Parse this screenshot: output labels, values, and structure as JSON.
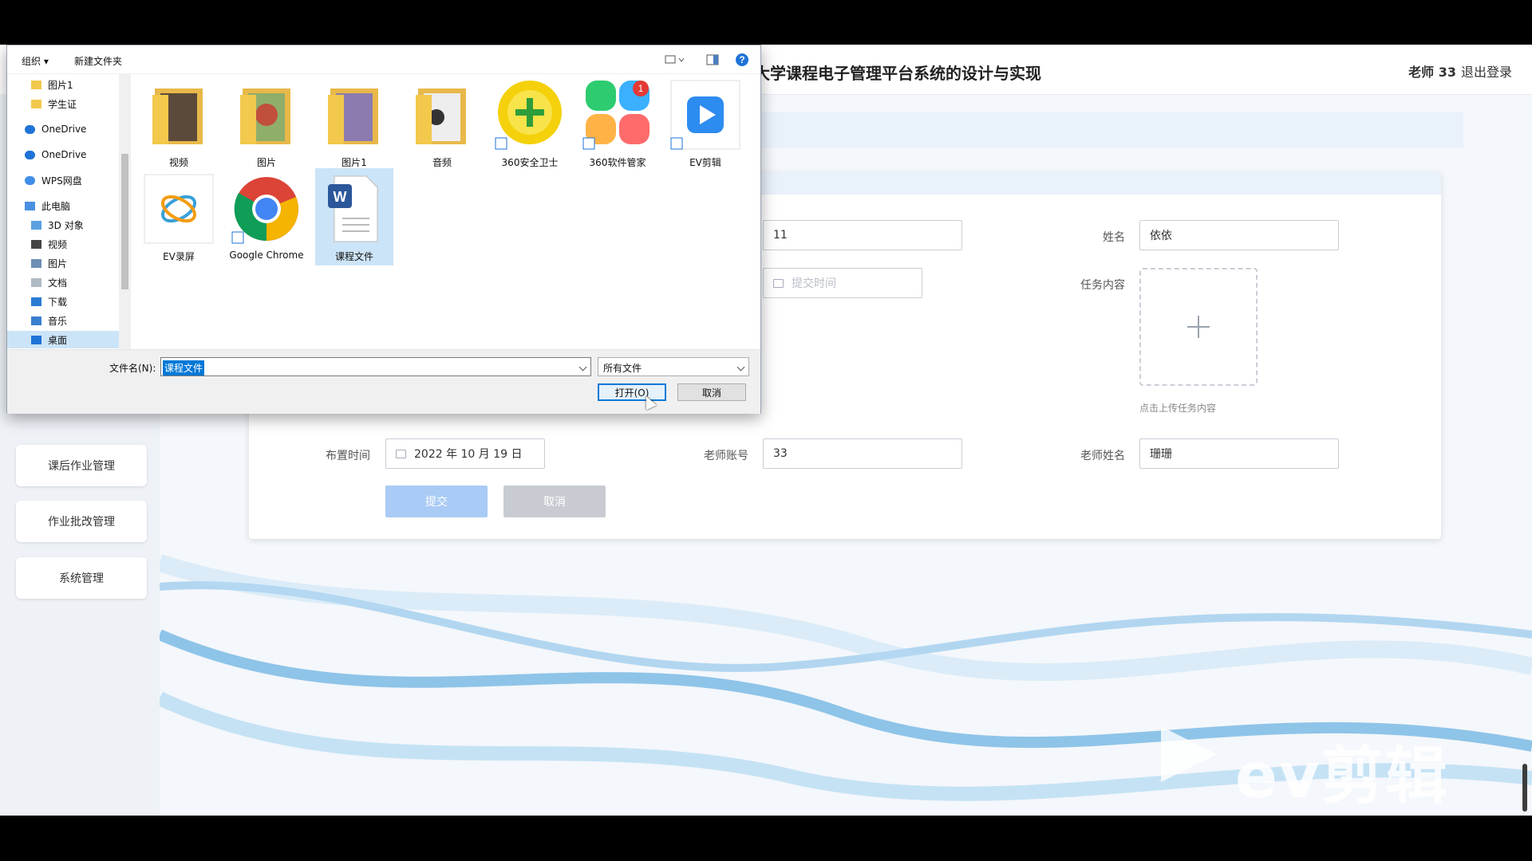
{
  "header": {
    "title": "大学课程电子管理平台系统的设计与实现",
    "user": "老师 33",
    "logout": "退出登录"
  },
  "sidebar": {
    "items": [
      "课后作业管理",
      "作业批改管理",
      "系统管理"
    ]
  },
  "form": {
    "field1_value": "11",
    "name_label": "姓名",
    "name_value": "依依",
    "submit_time_placeholder": "提交时间",
    "task_content_label": "任务内容",
    "upload_hint": "点击上传任务内容",
    "assign_time_label": "布置时间",
    "assign_time_value": "2022 年 10 月 19 日",
    "teacher_account_label": "老师账号",
    "teacher_account_value": "33",
    "teacher_name_label": "老师姓名",
    "teacher_name_value": "珊珊",
    "submit_button": "提交",
    "cancel_button": "取消"
  },
  "watermark": "ev剪辑",
  "dialog": {
    "toolbar": {
      "organize": "组织 ▾",
      "new_folder": "新建文件夹"
    },
    "nav": [
      {
        "label": "图片1",
        "icon": "folder-icon"
      },
      {
        "label": "学生证",
        "icon": "folder-icon"
      },
      {
        "label": "OneDrive",
        "icon": "cloud-icon"
      },
      {
        "label": "OneDrive",
        "icon": "cloud-icon"
      },
      {
        "label": "WPS网盘",
        "icon": "cloud-icon"
      },
      {
        "label": "此电脑",
        "icon": "computer-icon"
      },
      {
        "label": "3D 对象",
        "icon": "cube-icon"
      },
      {
        "label": "视频",
        "icon": "video-icon"
      },
      {
        "label": "图片",
        "icon": "picture-icon"
      },
      {
        "label": "文档",
        "icon": "document-icon"
      },
      {
        "label": "下载",
        "icon": "download-icon"
      },
      {
        "label": "音乐",
        "icon": "music-icon"
      },
      {
        "label": "桌面",
        "icon": "desktop-icon"
      }
    ],
    "files": [
      {
        "label": "视频",
        "icon": "folder-icon"
      },
      {
        "label": "图片",
        "icon": "folder-icon"
      },
      {
        "label": "图片1",
        "icon": "folder-icon"
      },
      {
        "label": "音频",
        "icon": "folder-icon"
      },
      {
        "label": "360安全卫士",
        "icon": "shortcut-icon"
      },
      {
        "label": "360软件管家",
        "icon": "shortcut-icon",
        "badge": "1"
      },
      {
        "label": "EV剪辑",
        "icon": "shortcut-icon"
      },
      {
        "label": "EV录屏",
        "icon": "app-icon"
      },
      {
        "label": "Google Chrome",
        "icon": "chrome-icon"
      },
      {
        "label": "课程文件",
        "icon": "word-document-icon"
      }
    ],
    "filename_label": "文件名(N):",
    "filename_value": "课程文件",
    "filetype_value": "所有文件",
    "open_button": "打开(O)",
    "cancel_button": "取消"
  },
  "colors": {
    "primary_button": "#a9cbf5",
    "disabled_button": "#c8ccd2",
    "selection": "#0078d7"
  }
}
